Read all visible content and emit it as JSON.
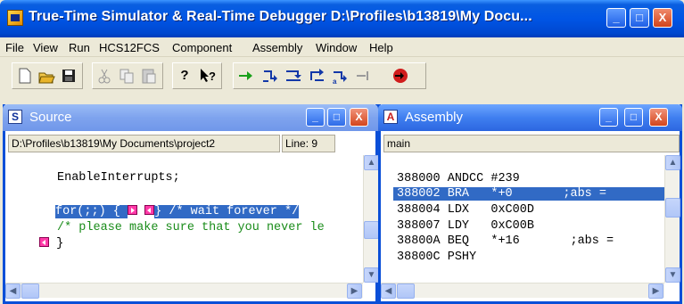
{
  "app": {
    "title": "True-Time Simulator & Real-Time Debugger   D:\\Profiles\\b13819\\My Docu...",
    "caption_buttons": {
      "minimize": "_",
      "maximize": "□",
      "close": "X"
    }
  },
  "menu": [
    "File",
    "View",
    "Run",
    "HCS12FCS",
    "Component",
    "Assembly",
    "Window",
    "Help"
  ],
  "toolbar": {
    "icons": [
      "new-file-icon",
      "open-folder-icon",
      "save-icon",
      "cut-icon",
      "copy-icon",
      "paste-icon",
      "help-icon",
      "context-help-icon",
      "start-continue-icon",
      "single-step-icon",
      "step-over-icon",
      "step-out-icon",
      "assembly-step-icon",
      "halt-icon",
      "reset-icon"
    ],
    "colors": {
      "green": "#1aa01a",
      "blue": "#1238a8",
      "red": "#d01c1c"
    }
  },
  "source_window": {
    "title": "Source",
    "icon_letter": "S",
    "path": "D:\\Profiles\\b13819\\My Documents\\project2",
    "line_label": "Line: 9",
    "lines": [
      {
        "text": "EnableInterrupts;",
        "selected": false
      },
      {
        "text": "for(;;) {",
        "after": "} /* wait forever */",
        "selected": true
      },
      {
        "text": "/* please make sure that you never le",
        "selected": false,
        "comment": true
      },
      {
        "text": "}",
        "selected": false
      }
    ]
  },
  "assembly_window": {
    "title": "Assembly",
    "icon_letter": "A",
    "function": "main",
    "rows": [
      {
        "addr": "388000",
        "op": "ANDCC",
        "arg": "#239",
        "comment": ""
      },
      {
        "addr": "388002",
        "op": "BRA",
        "arg": "*+0",
        "comment": ";abs =",
        "selected": true
      },
      {
        "addr": "388004",
        "op": "LDX",
        "arg": "0xC00D",
        "comment": ""
      },
      {
        "addr": "388007",
        "op": "LDY",
        "arg": "0xC00B",
        "comment": ""
      },
      {
        "addr": "38800A",
        "op": "BEQ",
        "arg": "*+16",
        "comment": ";abs ="
      },
      {
        "addr": "38800C",
        "op": "PSHY",
        "arg": "",
        "comment": ""
      }
    ]
  }
}
